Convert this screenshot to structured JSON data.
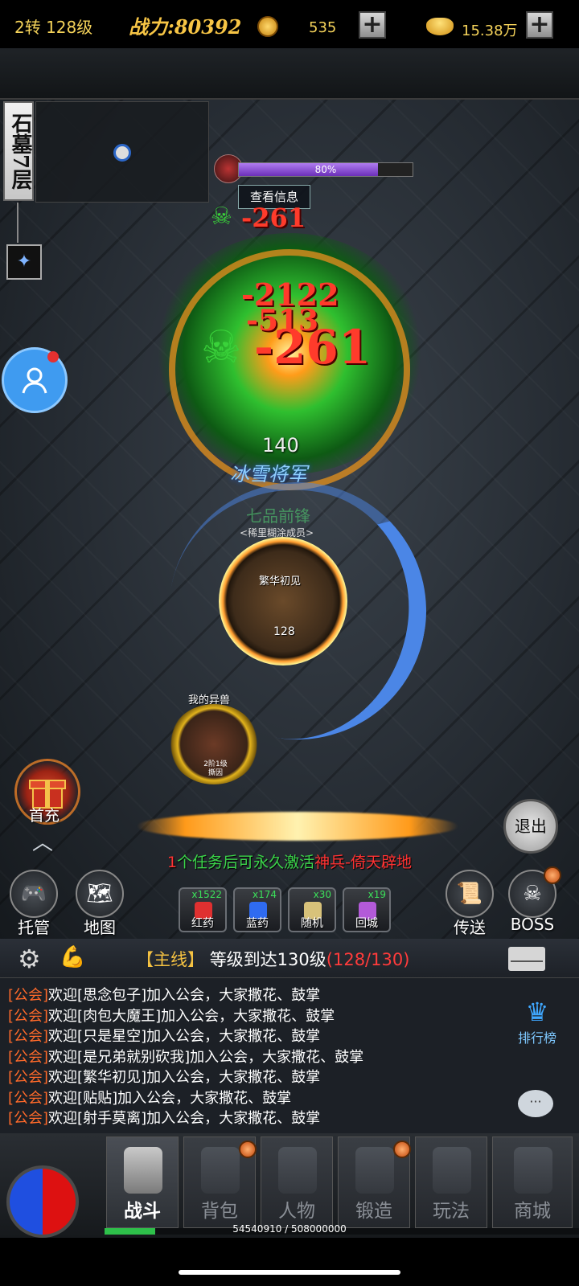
{
  "topbar": {
    "level": "2转 128级",
    "power_label": "战力:",
    "power_value": "80392",
    "coins": "535",
    "plus": "+",
    "ingots": "15.38万"
  },
  "map": {
    "name": "石墓7层"
  },
  "boss": {
    "hp_percent": 80,
    "hp_label": "80%",
    "info_button": "查看信息",
    "level": "140",
    "name": "冰雪将军",
    "damage": [
      "-261",
      "-2122",
      "-513",
      "-261"
    ]
  },
  "player": {
    "title": "七品前锋",
    "guild_tag": "<稀里糊涂成员>",
    "name": "繁华初见",
    "level": "128"
  },
  "pet": {
    "title": "我的异兽",
    "sub1": "2阶1级",
    "sub2": "撕因"
  },
  "first_charge_label": "首充",
  "exit_label": "退出",
  "quest_tip": {
    "count": "1",
    "text": "个任务后可永久激活",
    "weapon": "神兵-倚天辟地"
  },
  "left_buttons": [
    {
      "label": "托管",
      "icon": "gamepad-icon"
    },
    {
      "label": "地图",
      "icon": "map-icon"
    }
  ],
  "right_buttons": [
    {
      "label": "传送",
      "icon": "scroll-icon"
    },
    {
      "label": "BOSS",
      "icon": "boss-skull-icon"
    }
  ],
  "slots": [
    {
      "label": "红药",
      "count": "x1522",
      "color": "#e03030"
    },
    {
      "label": "蓝药",
      "count": "x174",
      "color": "#2f6bf0"
    },
    {
      "label": "随机",
      "count": "x30",
      "color": "#d8c27a"
    },
    {
      "label": "回城",
      "count": "x19",
      "color": "#b35ad8"
    }
  ],
  "quest": {
    "tag": "【主线】",
    "text": "等级到达130级",
    "progress": "(128/130)"
  },
  "chat": [
    {
      "channel": "[公会]",
      "text": "欢迎[思念包子]加入公会，大家撒花、鼓掌"
    },
    {
      "channel": "[公会]",
      "text": "欢迎[肉包大魔王]加入公会，大家撒花、鼓掌"
    },
    {
      "channel": "[公会]",
      "text": "欢迎[只是星空]加入公会，大家撒花、鼓掌"
    },
    {
      "channel": "[公会]",
      "text": "欢迎[是兄弟就别砍我]加入公会，大家撒花、鼓掌"
    },
    {
      "channel": "[公会]",
      "text": "欢迎[繁华初见]加入公会，大家撒花、鼓掌"
    },
    {
      "channel": "[公会]",
      "text": "欢迎[贴贴]加入公会，大家撒花、鼓掌"
    },
    {
      "channel": "[公会]",
      "text": "欢迎[射手莫离]加入公会，大家撒花、鼓掌"
    }
  ],
  "rank_label": "排行榜",
  "nav": [
    {
      "label": "战斗",
      "active": true
    },
    {
      "label": "背包",
      "badge": true
    },
    {
      "label": "人物"
    },
    {
      "label": "锻造",
      "badge": true
    },
    {
      "label": "玩法"
    },
    {
      "label": "商城"
    }
  ],
  "exp": {
    "text": "54540910 / 508000000",
    "fraction": 0.107
  }
}
